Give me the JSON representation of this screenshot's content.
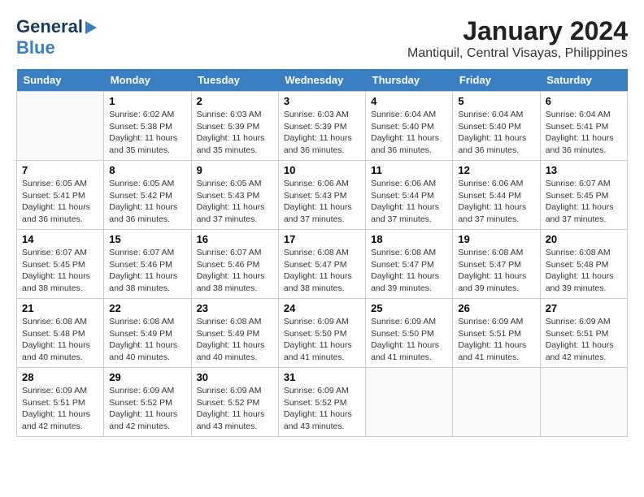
{
  "logo": {
    "line1": "General",
    "line2": "Blue"
  },
  "title": "January 2024",
  "subtitle": "Mantiquil, Central Visayas, Philippines",
  "headers": [
    "Sunday",
    "Monday",
    "Tuesday",
    "Wednesday",
    "Thursday",
    "Friday",
    "Saturday"
  ],
  "weeks": [
    [
      {
        "day": "",
        "info": ""
      },
      {
        "day": "1",
        "info": "Sunrise: 6:02 AM\nSunset: 5:38 PM\nDaylight: 11 hours\nand 35 minutes."
      },
      {
        "day": "2",
        "info": "Sunrise: 6:03 AM\nSunset: 5:39 PM\nDaylight: 11 hours\nand 35 minutes."
      },
      {
        "day": "3",
        "info": "Sunrise: 6:03 AM\nSunset: 5:39 PM\nDaylight: 11 hours\nand 36 minutes."
      },
      {
        "day": "4",
        "info": "Sunrise: 6:04 AM\nSunset: 5:40 PM\nDaylight: 11 hours\nand 36 minutes."
      },
      {
        "day": "5",
        "info": "Sunrise: 6:04 AM\nSunset: 5:40 PM\nDaylight: 11 hours\nand 36 minutes."
      },
      {
        "day": "6",
        "info": "Sunrise: 6:04 AM\nSunset: 5:41 PM\nDaylight: 11 hours\nand 36 minutes."
      }
    ],
    [
      {
        "day": "7",
        "info": "Sunrise: 6:05 AM\nSunset: 5:41 PM\nDaylight: 11 hours\nand 36 minutes."
      },
      {
        "day": "8",
        "info": "Sunrise: 6:05 AM\nSunset: 5:42 PM\nDaylight: 11 hours\nand 36 minutes."
      },
      {
        "day": "9",
        "info": "Sunrise: 6:05 AM\nSunset: 5:43 PM\nDaylight: 11 hours\nand 37 minutes."
      },
      {
        "day": "10",
        "info": "Sunrise: 6:06 AM\nSunset: 5:43 PM\nDaylight: 11 hours\nand 37 minutes."
      },
      {
        "day": "11",
        "info": "Sunrise: 6:06 AM\nSunset: 5:44 PM\nDaylight: 11 hours\nand 37 minutes."
      },
      {
        "day": "12",
        "info": "Sunrise: 6:06 AM\nSunset: 5:44 PM\nDaylight: 11 hours\nand 37 minutes."
      },
      {
        "day": "13",
        "info": "Sunrise: 6:07 AM\nSunset: 5:45 PM\nDaylight: 11 hours\nand 37 minutes."
      }
    ],
    [
      {
        "day": "14",
        "info": "Sunrise: 6:07 AM\nSunset: 5:45 PM\nDaylight: 11 hours\nand 38 minutes."
      },
      {
        "day": "15",
        "info": "Sunrise: 6:07 AM\nSunset: 5:46 PM\nDaylight: 11 hours\nand 38 minutes."
      },
      {
        "day": "16",
        "info": "Sunrise: 6:07 AM\nSunset: 5:46 PM\nDaylight: 11 hours\nand 38 minutes."
      },
      {
        "day": "17",
        "info": "Sunrise: 6:08 AM\nSunset: 5:47 PM\nDaylight: 11 hours\nand 38 minutes."
      },
      {
        "day": "18",
        "info": "Sunrise: 6:08 AM\nSunset: 5:47 PM\nDaylight: 11 hours\nand 39 minutes."
      },
      {
        "day": "19",
        "info": "Sunrise: 6:08 AM\nSunset: 5:47 PM\nDaylight: 11 hours\nand 39 minutes."
      },
      {
        "day": "20",
        "info": "Sunrise: 6:08 AM\nSunset: 5:48 PM\nDaylight: 11 hours\nand 39 minutes."
      }
    ],
    [
      {
        "day": "21",
        "info": "Sunrise: 6:08 AM\nSunset: 5:48 PM\nDaylight: 11 hours\nand 40 minutes."
      },
      {
        "day": "22",
        "info": "Sunrise: 6:08 AM\nSunset: 5:49 PM\nDaylight: 11 hours\nand 40 minutes."
      },
      {
        "day": "23",
        "info": "Sunrise: 6:08 AM\nSunset: 5:49 PM\nDaylight: 11 hours\nand 40 minutes."
      },
      {
        "day": "24",
        "info": "Sunrise: 6:09 AM\nSunset: 5:50 PM\nDaylight: 11 hours\nand 41 minutes."
      },
      {
        "day": "25",
        "info": "Sunrise: 6:09 AM\nSunset: 5:50 PM\nDaylight: 11 hours\nand 41 minutes."
      },
      {
        "day": "26",
        "info": "Sunrise: 6:09 AM\nSunset: 5:51 PM\nDaylight: 11 hours\nand 41 minutes."
      },
      {
        "day": "27",
        "info": "Sunrise: 6:09 AM\nSunset: 5:51 PM\nDaylight: 11 hours\nand 42 minutes."
      }
    ],
    [
      {
        "day": "28",
        "info": "Sunrise: 6:09 AM\nSunset: 5:51 PM\nDaylight: 11 hours\nand 42 minutes."
      },
      {
        "day": "29",
        "info": "Sunrise: 6:09 AM\nSunset: 5:52 PM\nDaylight: 11 hours\nand 42 minutes."
      },
      {
        "day": "30",
        "info": "Sunrise: 6:09 AM\nSunset: 5:52 PM\nDaylight: 11 hours\nand 43 minutes."
      },
      {
        "day": "31",
        "info": "Sunrise: 6:09 AM\nSunset: 5:52 PM\nDaylight: 11 hours\nand 43 minutes."
      },
      {
        "day": "",
        "info": ""
      },
      {
        "day": "",
        "info": ""
      },
      {
        "day": "",
        "info": ""
      }
    ]
  ]
}
